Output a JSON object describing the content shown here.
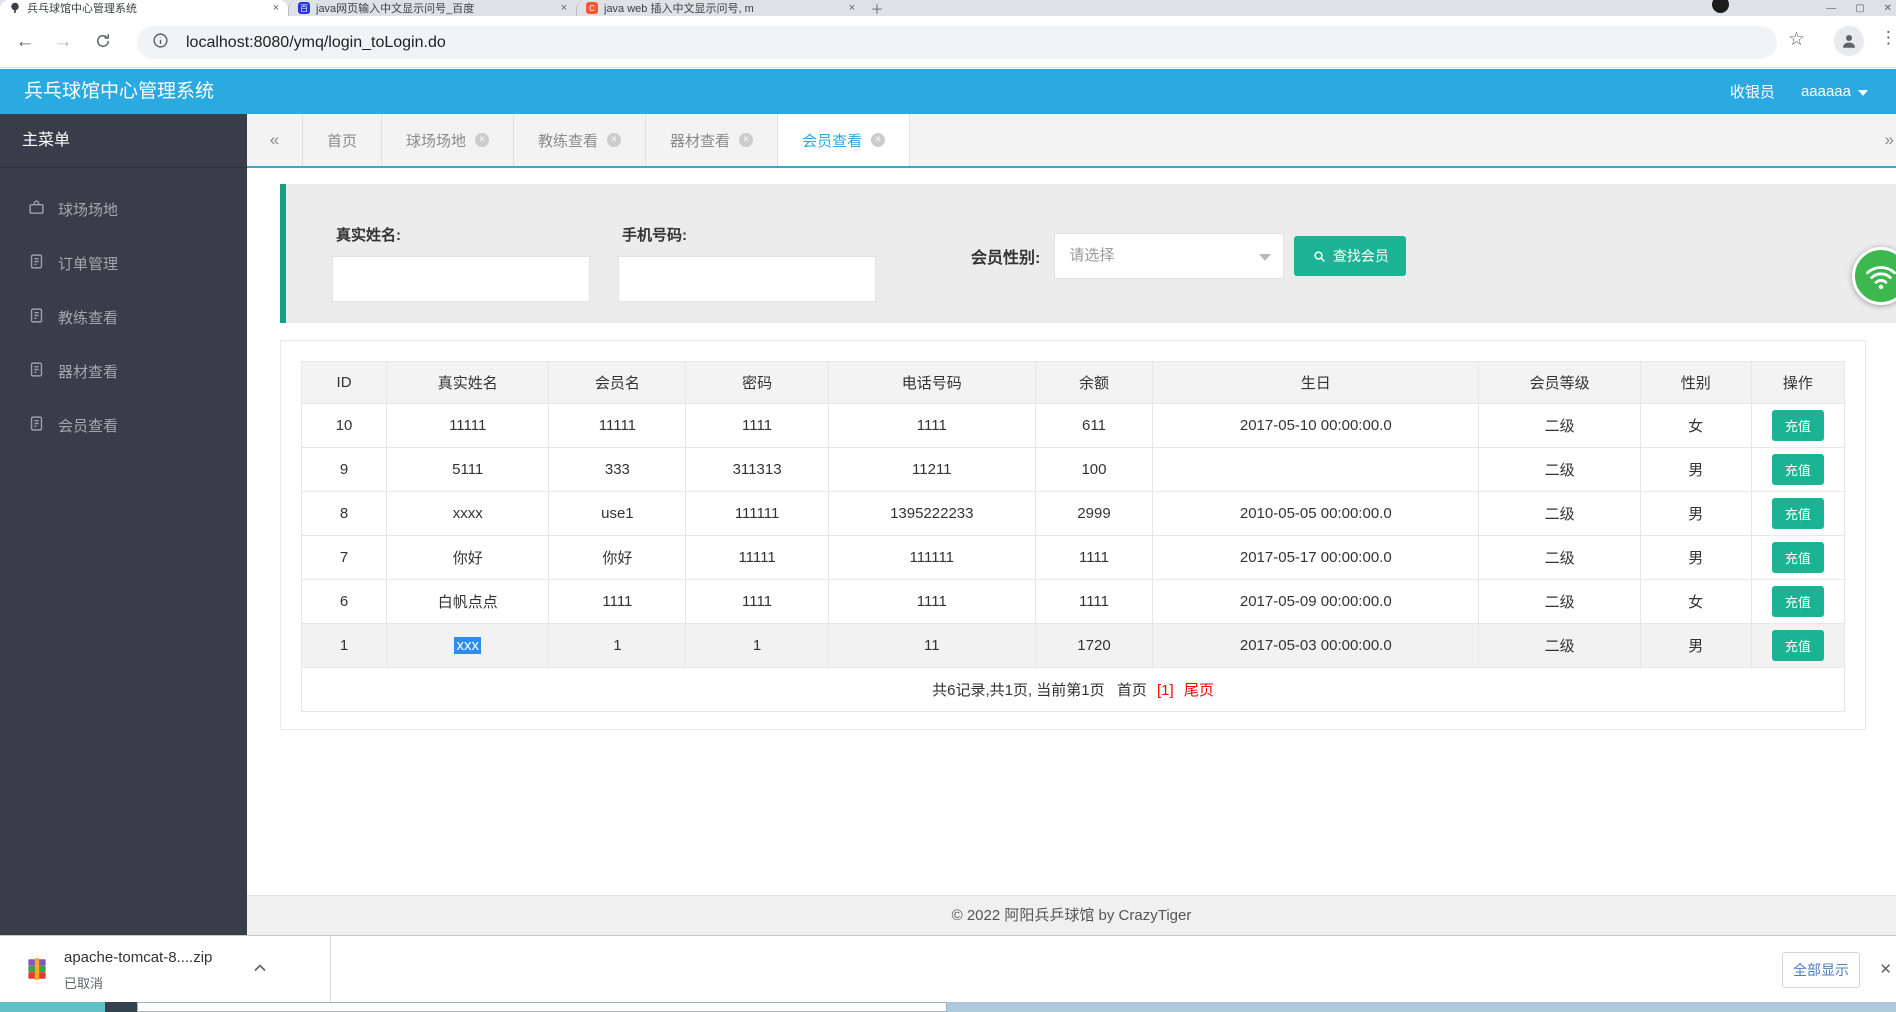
{
  "browser": {
    "tabs": [
      {
        "title": "兵乓球馆中心管理系统",
        "icon": "paddle",
        "active": true
      },
      {
        "title": "java网页输入中文显示问号_百度",
        "icon": "baidu",
        "active": false
      },
      {
        "title": "java web 插入中文显示问号, m",
        "icon": "csdn",
        "active": false
      }
    ],
    "url": "localhost:8080/ymq/login_toLogin.do"
  },
  "app_header": {
    "title": "兵乓球馆中心管理系统",
    "role": "收银员",
    "username": "aaaaaa"
  },
  "sidebar": {
    "heading": "主菜单",
    "items": [
      {
        "label": "球场场地",
        "icon": "briefcase-icon"
      },
      {
        "label": "订单管理",
        "icon": "file-icon"
      },
      {
        "label": "教练查看",
        "icon": "file-icon"
      },
      {
        "label": "器材查看",
        "icon": "file-icon"
      },
      {
        "label": "会员查看",
        "icon": "file-icon"
      }
    ]
  },
  "content_tabs": [
    {
      "label": "首页",
      "closable": false,
      "active": false
    },
    {
      "label": "球场场地",
      "closable": true,
      "active": false
    },
    {
      "label": "教练查看",
      "closable": true,
      "active": false
    },
    {
      "label": "器材查看",
      "closable": true,
      "active": false
    },
    {
      "label": "会员查看",
      "closable": true,
      "active": true
    }
  ],
  "search_form": {
    "name_label": "真实姓名:",
    "phone_label": "手机号码:",
    "gender_label": "会员性别:",
    "gender_placeholder": "请选择",
    "button_label": "查找会员"
  },
  "member_table": {
    "headers": [
      "ID",
      "真实姓名",
      "会员名",
      "密码",
      "电话号码",
      "余额",
      "生日",
      "会员等级",
      "性别",
      "操作"
    ],
    "action_label": "充值",
    "rows": [
      [
        "10",
        "11111",
        "11111",
        "1111",
        "1111",
        "611",
        "2017-05-10 00:00:00.0",
        "二级",
        "女"
      ],
      [
        "9",
        "5111",
        "333",
        "311313",
        "11211",
        "100",
        "",
        "二级",
        "男"
      ],
      [
        "8",
        "xxxx",
        "use1",
        "111111",
        "1395222233",
        "2999",
        "2010-05-05 00:00:00.0",
        "二级",
        "男"
      ],
      [
        "7",
        "你好",
        "你好",
        "11111",
        "111111",
        "1111",
        "2017-05-17 00:00:00.0",
        "二级",
        "男"
      ],
      [
        "6",
        "白帆点点",
        "1111",
        "1111",
        "1111",
        "1111",
        "2017-05-09 00:00:00.0",
        "二级",
        "女"
      ],
      [
        "1",
        "xxx",
        "1",
        "1",
        "11",
        "1720",
        "2017-05-03 00:00:00.0",
        "二级",
        "男"
      ]
    ],
    "highlight_row": 5,
    "selection": {
      "row": 5,
      "col": 1
    },
    "pagination": {
      "summary": "共6记录,共1页, 当前第1页",
      "first": "首页",
      "current": "[1]",
      "last": "尾页"
    }
  },
  "page_footer": {
    "copyright": "© 2022 阿阳兵乒球馆 by CrazyTiger"
  },
  "download_bar": {
    "filename": "apache-tomcat-8....zip",
    "status": "已取消",
    "show_all_label": "全部显示"
  },
  "colors": {
    "header_blue": "#2ba9e1",
    "accent_teal": "#169f85",
    "button_teal": "#1ab394",
    "sidebar_dark": "#393d49",
    "pagination_red": "#ff0000",
    "selection_blue": "#308ce8",
    "wifi_green": "#3cb84e"
  }
}
